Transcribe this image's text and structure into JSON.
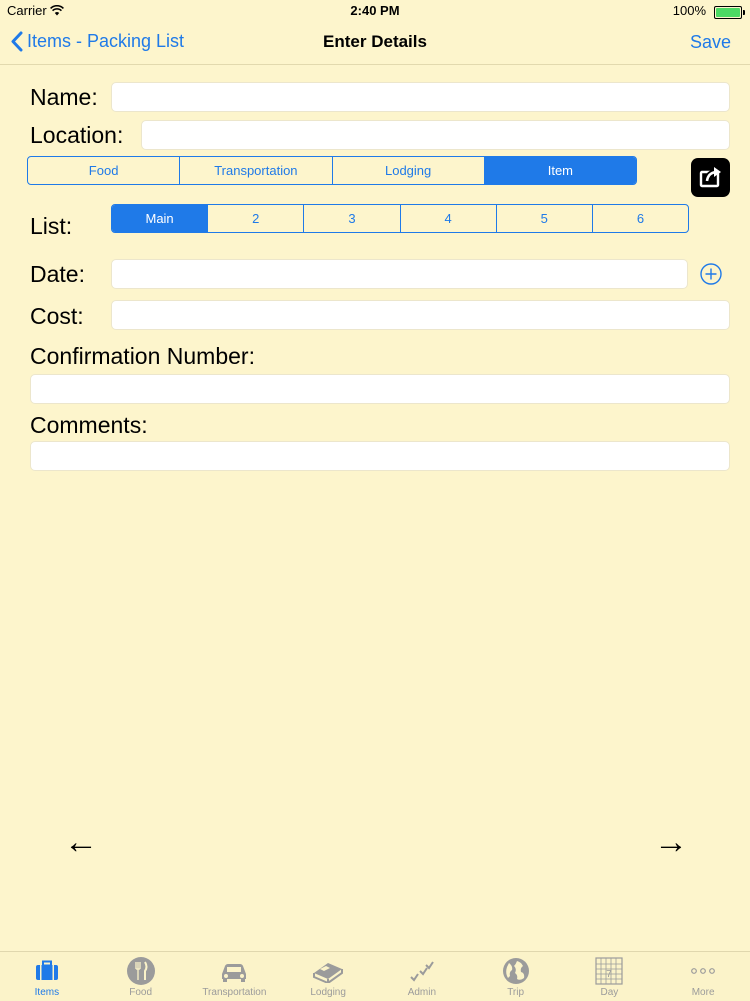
{
  "status": {
    "carrier": "Carrier",
    "time": "2:40 PM",
    "battery": "100%"
  },
  "nav": {
    "back": "Items - Packing List",
    "title": "Enter Details",
    "save": "Save"
  },
  "form": {
    "name_label": "Name:",
    "name_value": "",
    "location_label": "Location:",
    "location_value": "",
    "category_segments": [
      "Food",
      "Transportation",
      "Lodging",
      "Item"
    ],
    "category_selected": "Item",
    "list_label": "List:",
    "list_segments": [
      "Main",
      "2",
      "3",
      "4",
      "5",
      "6"
    ],
    "list_selected": "Main",
    "date_label": "Date:",
    "date_value": "",
    "cost_label": "Cost:",
    "cost_value": "",
    "confirmation_label": "Confirmation Number:",
    "confirmation_value": "",
    "comments_label": "Comments:",
    "comments_value": ""
  },
  "arrows": {
    "prev": "←",
    "next": "→"
  },
  "tabs": [
    {
      "label": "Items",
      "icon": "suitcase-icon",
      "active": true
    },
    {
      "label": "Food",
      "icon": "fork-knife-icon",
      "active": false
    },
    {
      "label": "Transportation",
      "icon": "car-icon",
      "active": false
    },
    {
      "label": "Lodging",
      "icon": "bed-icon",
      "active": false
    },
    {
      "label": "Admin",
      "icon": "checkmarks-icon",
      "active": false
    },
    {
      "label": "Trip",
      "icon": "globe-icon",
      "active": false
    },
    {
      "label": "Day",
      "icon": "calendar-icon",
      "active": false
    },
    {
      "label": "More",
      "icon": "more-dots-icon",
      "active": false
    }
  ],
  "colors": {
    "accent": "#1f7ae8",
    "background": "#fdf5cc",
    "tab_inactive": "#9b9b9b"
  }
}
